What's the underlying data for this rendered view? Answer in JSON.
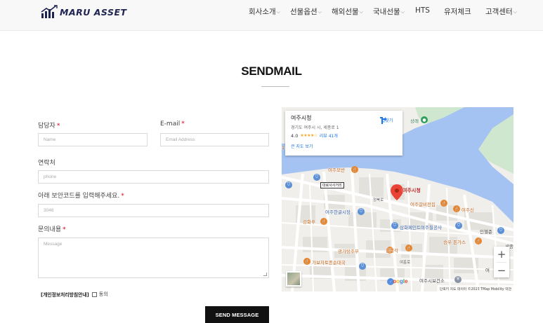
{
  "header": {
    "logo_text": "MARU ASSET",
    "nav": [
      {
        "label": "회사소개",
        "dropdown": true
      },
      {
        "label": "선물옵션",
        "dropdown": true
      },
      {
        "label": "해외선물",
        "dropdown": true
      },
      {
        "label": "국내선물",
        "dropdown": true
      },
      {
        "label": "HTS",
        "dropdown": false
      },
      {
        "label": "유저체크",
        "dropdown": false
      },
      {
        "label": "고객센터",
        "dropdown": true
      }
    ]
  },
  "page": {
    "title": "SENDMAIL"
  },
  "form": {
    "manager_label": "담당자",
    "manager_placeholder": "Name",
    "email_label": "E-mail",
    "email_placeholder": "Email Address",
    "contact_label": "연락처",
    "contact_placeholder": "phone",
    "captcha_label": "아래 보안코드를 입력해주세요.",
    "captcha_placeholder": "3046",
    "inquiry_label": "문의내용",
    "inquiry_placeholder": "Message",
    "required_mark": "*",
    "privacy_link": "[개인정보처리방침안내]",
    "agree_label": "동의",
    "agree_checked": false,
    "submit_label": "SEND MESSAGE"
  },
  "map": {
    "place_name": "여주시청",
    "address": "경기도 여주시 시, 세종로 1",
    "rating": "4.0",
    "stars": "★★★★☆",
    "reviews": "리뷰 41개",
    "bigger_map": "큰 지도 보기",
    "directions": "길찾기",
    "marker_label": "여주시청",
    "google": "Google",
    "attribution": "단축키   지도 데이터 ©2023 TMap Mobility   약관",
    "zoom_in": "+",
    "zoom_out": "−",
    "labels": {
      "yeojumoban": "여주모반",
      "daeroRoad": "대로사사거리",
      "yeojuHangeul": "여주한글시장",
      "jeongbuk": "정북로",
      "gangwonhu": "강화후",
      "samhwa": "삼화페인트여주칠공사",
      "hongmungak": "홍문각",
      "yeojuyeonyeon": "여주갈비전집",
      "yeojusin": "여주신",
      "inheljun": "인헬준",
      "sejong": "세종",
      "seungu": "승우 돈가스",
      "gwanga": "광가탕주부",
      "gabo": "가보자토종순대국",
      "yeojuhoreo": "여흥로",
      "yeojuhealth": "여주시보건소",
      "sanglae": "상래",
      "r15": "15",
      "yeo": "여",
      "yeojumain": "여주로",
      "zeojin": "중앙로",
      "jangan": "관중로",
      "r57": "57번길",
      "r98": "98번길",
      "bugyeong": "북부로"
    }
  }
}
